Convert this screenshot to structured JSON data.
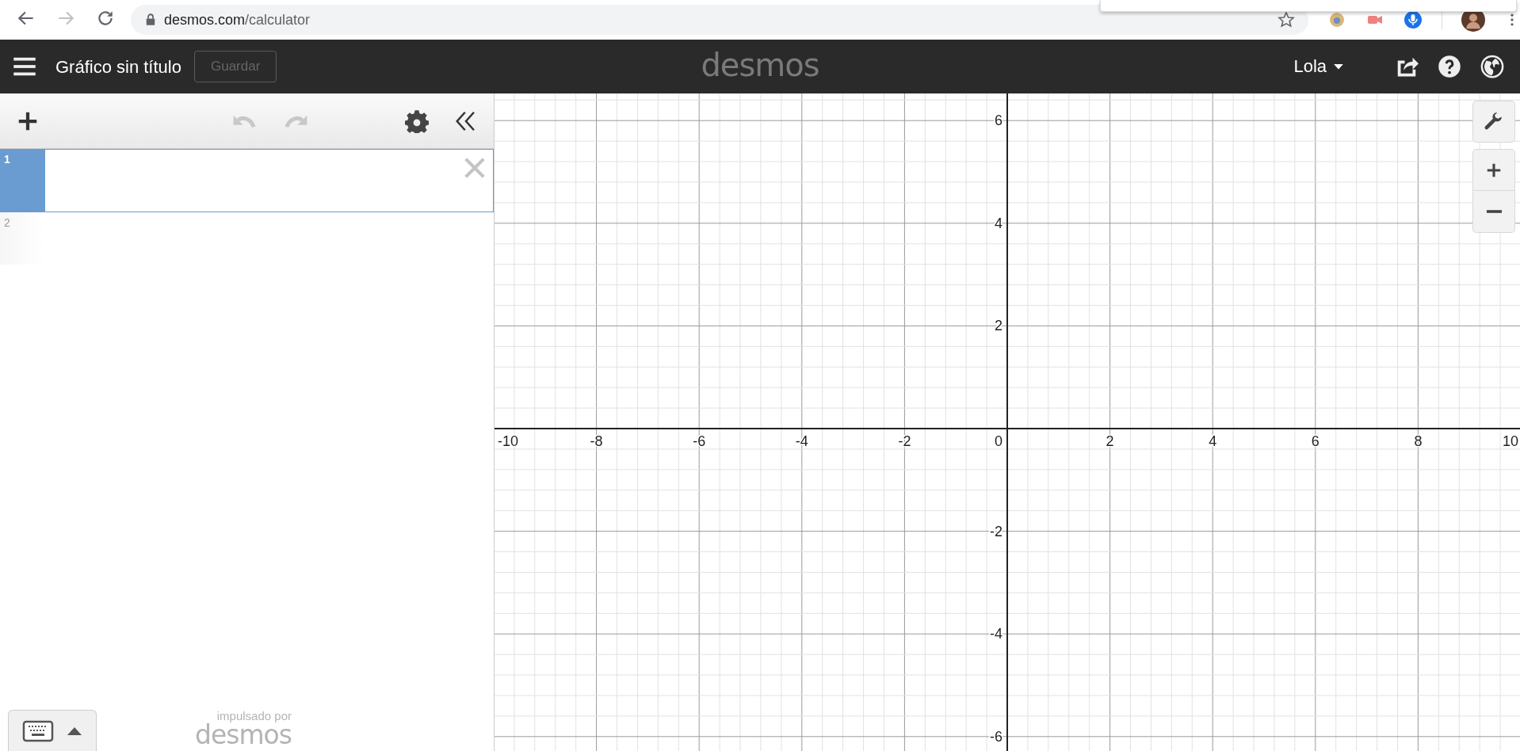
{
  "browser": {
    "url_host": "desmos.com",
    "url_path": "/calculator"
  },
  "header": {
    "title": "Gráfico sin título",
    "save_button": {
      "label": "Guardar",
      "disabled": true
    },
    "logo": "desmos",
    "user": "Lola"
  },
  "toolbar": {
    "undo_disabled": true,
    "redo_disabled": true
  },
  "expressions": [
    {
      "number": "1",
      "selected": true
    },
    {
      "number": "2",
      "selected": false
    }
  ],
  "graph": {
    "x_labels": [
      "-10",
      "-8",
      "-6",
      "-4",
      "-2",
      "0",
      "2",
      "4",
      "6",
      "8",
      "10"
    ],
    "y_labels": [
      "6",
      "4",
      "2",
      "-2",
      "-4",
      "-6"
    ]
  },
  "footer": {
    "powered_by": "impulsado por",
    "logo": "desmos"
  }
}
